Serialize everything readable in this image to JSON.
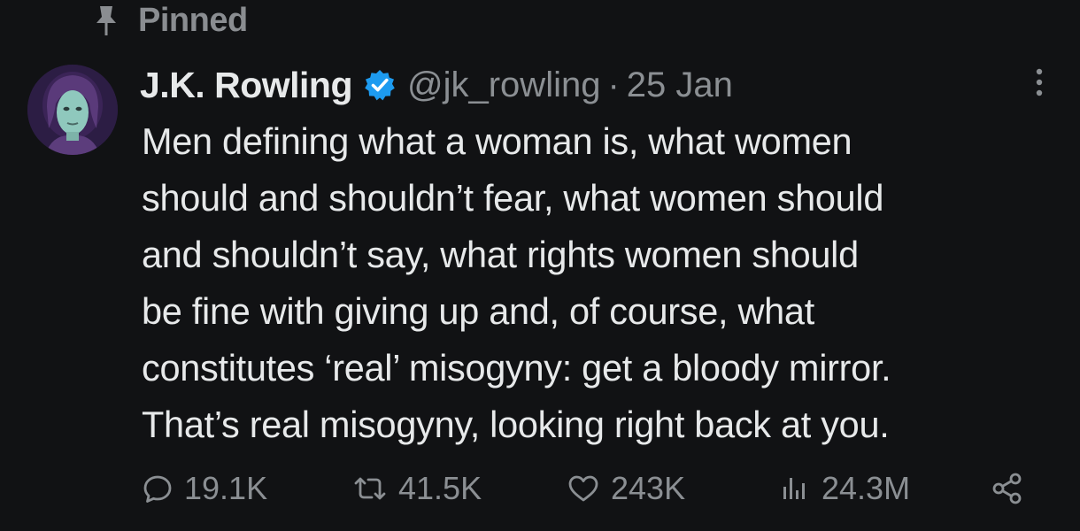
{
  "pinned": {
    "label": "Pinned",
    "icon": "pin-icon"
  },
  "tweet": {
    "author": {
      "name": "J.K. Rowling",
      "handle": "@jk_rowling",
      "verified": true,
      "avatar": "avatar"
    },
    "separator": "·",
    "date": "25 Jan",
    "text_lines": [
      "Men defining what a woman is, what women",
      "should and shouldn’t fear, what women should",
      "and shouldn’t say, what rights women should",
      "be fine with giving up and, of course, what",
      "constitutes ‘real’ misogyny: get a bloody mirror.",
      "That’s real misogyny, looking right back at you."
    ],
    "actions": {
      "replies": "19.1K",
      "retweets": "41.5K",
      "likes": "243K",
      "views": "24.3M"
    }
  },
  "colors": {
    "background": "#111214",
    "text": "#e7e9ea",
    "muted": "#8b8f93",
    "verified_badge": "#1d9bf0"
  }
}
